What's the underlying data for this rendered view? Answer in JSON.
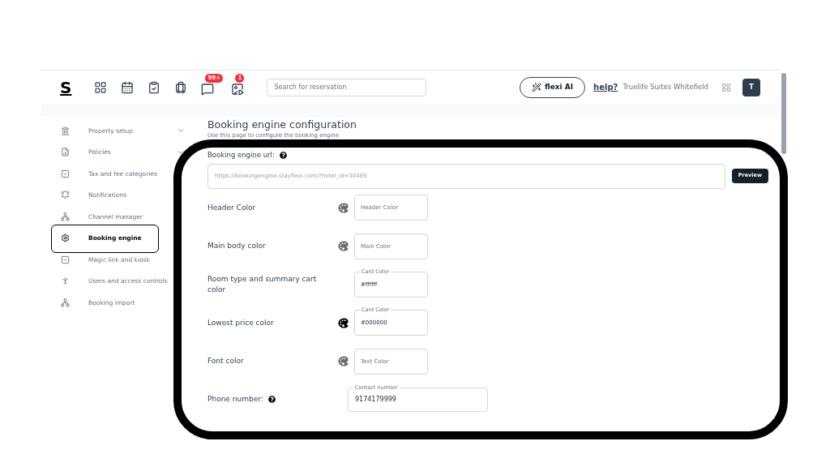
{
  "header": {
    "logo": "S",
    "badges": [
      {
        "count": "99+"
      },
      {
        "count": "1"
      }
    ],
    "search": {
      "placeholder": "Search for reservation"
    },
    "ai_button": "flexi AI",
    "help_link": "help?",
    "property": "Truelife Suites Whitefield",
    "avatar": "T"
  },
  "sidebar": {
    "items": [
      {
        "label": "Property setup",
        "expandable": true,
        "selected": false
      },
      {
        "label": "Policies",
        "expandable": true,
        "selected": false
      },
      {
        "label": "Tax and fee categories",
        "expandable": false,
        "selected": false
      },
      {
        "label": "Notifications",
        "expandable": false,
        "selected": false
      },
      {
        "label": "Channel manager",
        "expandable": false,
        "selected": false
      },
      {
        "label": "Booking engine",
        "expandable": false,
        "selected": true
      },
      {
        "label": "Magic link and kiosk",
        "expandable": false,
        "selected": false
      },
      {
        "label": "Users and access controls",
        "expandable": false,
        "selected": false
      },
      {
        "label": "Booking import",
        "expandable": false,
        "selected": false
      }
    ]
  },
  "page": {
    "title": "Booking engine configuration",
    "subtitle": "Use this page to configure the booking engine",
    "url_field": {
      "label": "Booking engine url:",
      "placeholder": "https://bookingengine.stayflexi.com/?hotel_id=30469",
      "button": "Preview"
    },
    "color_rows": [
      {
        "label": "Header Color",
        "palette": true,
        "placeholder": "Header Color"
      },
      {
        "label": "Main body color",
        "palette": true,
        "placeholder": "Main Color"
      },
      {
        "label": "Room type and summary cart color",
        "palette": false,
        "floating_label": "Card Color",
        "value": "#ffffff"
      },
      {
        "label": "Lowest price color",
        "palette": true,
        "floating_label": "Card Color",
        "value": "#000000"
      },
      {
        "label": "Font color",
        "palette": true,
        "placeholder": "Text Color"
      }
    ],
    "phone": {
      "label": "Phone number:",
      "floating_label": "Contact number",
      "value": "9174179999"
    }
  }
}
